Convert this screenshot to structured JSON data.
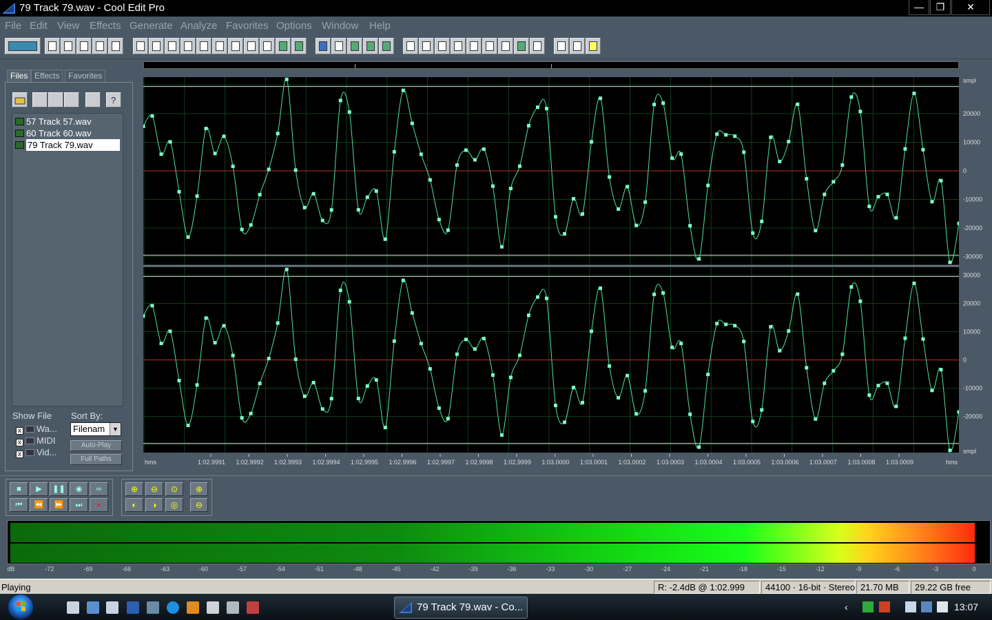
{
  "window": {
    "title": "79 Track 79.wav - Cool Edit Pro",
    "minimize": "—",
    "maximize": "❐",
    "close": "✕"
  },
  "menu": [
    "File",
    "Edit",
    "View",
    "Effects",
    "Generate",
    "Analyze",
    "Favorites",
    "Options",
    "Window",
    "Help"
  ],
  "organizer": {
    "tabs": [
      "Files",
      "Effects",
      "Favorites"
    ],
    "files": [
      "57 Track 57.wav",
      "60 Track 60.wav",
      "79 Track 79.wav"
    ],
    "selected_file_index": 2,
    "show_file_label": "Show File",
    "show_file_types": [
      {
        "label": "Wa...",
        "checked": true
      },
      {
        "label": "MIDI",
        "checked": true
      },
      {
        "label": "Vid...",
        "checked": true
      }
    ],
    "sort_by_label": "Sort By:",
    "sort_by_value": "Filenam",
    "auto_play": "Auto-Play",
    "full_paths": "Full Paths"
  },
  "waveform": {
    "y_unit": "smpl",
    "y_ticks": [
      "20000",
      "10000",
      "0",
      "-10000",
      "-20000",
      "-30000"
    ],
    "y_ticks_bottom": [
      "30000",
      "20000",
      "10000",
      "0",
      "-10000",
      "-20000"
    ],
    "x_unit": "hms",
    "x_ticks": [
      "1:02.9991",
      "1:02.9992",
      "1:02.9993",
      "1:02.9994",
      "1:02.9995",
      "1:02.9996",
      "1:02.9997",
      "1:02.9998",
      "1:02.9999",
      "1:03.0000",
      "1:03.0001",
      "1:03.0002",
      "1:03.0003",
      "1:03.0004",
      "1:03.0005",
      "1:03.0006",
      "1:03.0007",
      "1:03.0008",
      "1:03.0009"
    ],
    "colors": {
      "wave": "#4fe39a",
      "sample": "#7dffc6",
      "zero_line": "#b8341a",
      "grid": "#0f3e1e",
      "background": "#000000"
    }
  },
  "meter": {
    "scale": [
      "dB",
      "-72",
      "-69",
      "-66",
      "-63",
      "-60",
      "-57",
      "-54",
      "-51",
      "-48",
      "-45",
      "-42",
      "-39",
      "-36",
      "-33",
      "-30",
      "-27",
      "-24",
      "-21",
      "-18",
      "-15",
      "-12",
      "-9",
      "-6",
      "-3",
      "0"
    ]
  },
  "status": {
    "text": "Playing",
    "level": "R: -2.4dB @   1:02.999",
    "format": "44100 · 16-bit · Stereo",
    "size": "21.70 MB",
    "free": "29.22 GB free"
  },
  "taskbar": {
    "task_label": "79 Track 79.wav - Co...",
    "clock": "13:07"
  }
}
